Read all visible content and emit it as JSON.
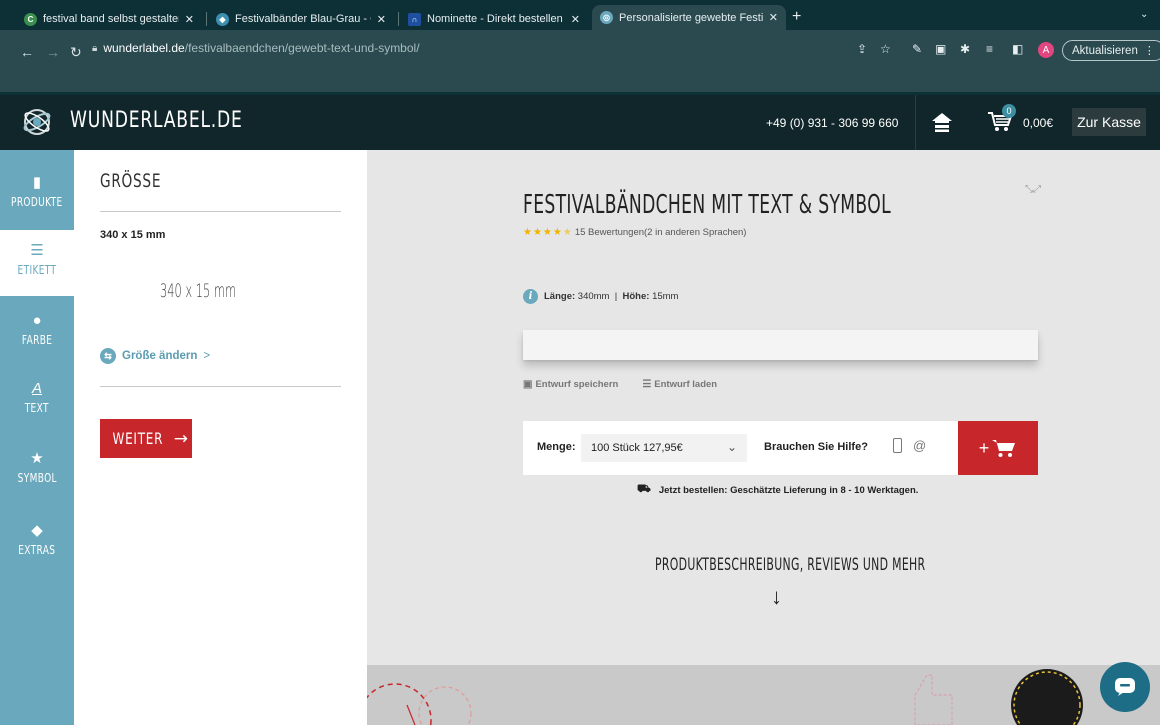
{
  "browser": {
    "tabs": [
      {
        "title": "festival band selbst gestalten - ",
        "favicon_color": "#3a8f4e",
        "favicon_glyph": "C",
        "close": "✕"
      },
      {
        "title": "Festivalbänder Blau-Grau - Gü",
        "favicon_color": "#3c8fb0",
        "favicon_glyph": "◆",
        "close": "✕"
      },
      {
        "title": "Nominette - Direkt bestellen - ",
        "favicon_color": "#1f4fa0",
        "favicon_glyph": "∩",
        "close": "✕"
      },
      {
        "title": "Personalisierte gewebte Festiv",
        "favicon_color": "#6aa9bd",
        "favicon_glyph": "◎",
        "close": "✕"
      }
    ],
    "new_tab": "+",
    "url_host": "wunderlabel.de",
    "url_path": "/festivalbaendchen/gewebt-text-und-symbol/",
    "profile_letter": "A",
    "update_label": "Aktualisieren"
  },
  "header": {
    "logo_text": "WUNDERLABEL.DE",
    "phone": "+49 (0) 931 - 306 99 660",
    "cart_count": "0",
    "cart_total": "0,00€",
    "checkout_label": "Zur Kasse"
  },
  "sidebar": {
    "items": [
      {
        "label": "PRODUKTE",
        "icon": "bookmark-icon"
      },
      {
        "label": "ETIKETT",
        "icon": "sliders-icon"
      },
      {
        "label": "FARBE",
        "icon": "drop-icon"
      },
      {
        "label": "TEXT",
        "icon": "text-a-icon"
      },
      {
        "label": "SYMBOL",
        "icon": "star-icon"
      },
      {
        "label": "EXTRAS",
        "icon": "tag-icon"
      }
    ]
  },
  "panel": {
    "title": "GRÖSSE",
    "size_label": "340 x 15 mm",
    "size_preview": "340 x 15 mm",
    "change_size": "Größe ändern",
    "next_label": "WEITER"
  },
  "product": {
    "title": "FESTIVALBÄNDCHEN MIT TEXT & SYMBOL",
    "rating_stars": "★★★★",
    "rating_value": 4.5,
    "reviews": "15 Bewertungen(2 in anderen Sprachen)",
    "length_label": "Länge:",
    "length_value": "340mm",
    "height_label": "Höhe:",
    "height_value": "15mm",
    "save_draft": "Entwurf speichern",
    "load_draft": "Entwurf laden",
    "qty_label": "Menge:",
    "qty_value": "100 Stück 127,95€",
    "help_label": "Brauchen Sie Hilfe?",
    "add_to_cart": "+",
    "delivery": "Jetzt bestellen: Geschätzte Lieferung in 8 - 10 Werktagen.",
    "more_title": "PRODUKTBESCHREIBUNG, REVIEWS UND MEHR",
    "more_arrow": "↓"
  },
  "colors": {
    "accent_red": "#c7262b",
    "sidebar_blue": "#6aa9bd",
    "header_dark": "#11262a",
    "star_gold": "#f0b400"
  }
}
